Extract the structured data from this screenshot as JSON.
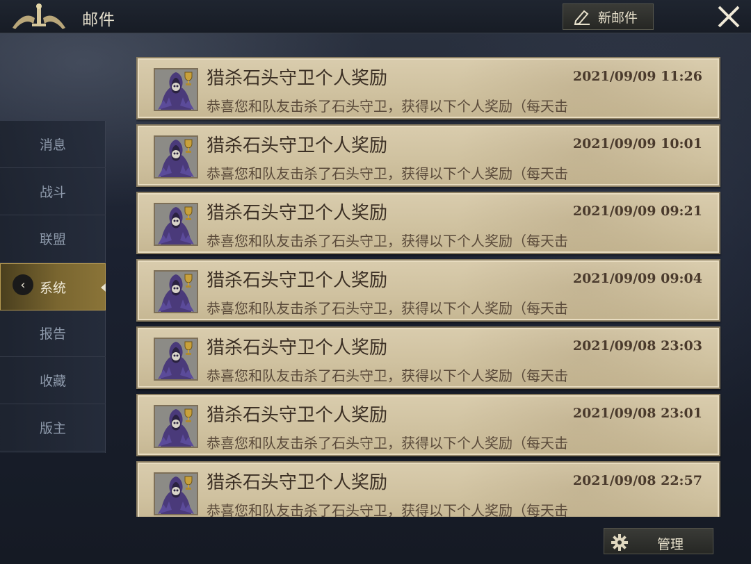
{
  "header": {
    "title": "邮件",
    "new_mail_label": "新邮件"
  },
  "sidebar": {
    "items": [
      {
        "label": "消息",
        "active": false
      },
      {
        "label": "战斗",
        "active": false
      },
      {
        "label": "联盟",
        "active": false
      },
      {
        "label": "系统",
        "active": true
      },
      {
        "label": "报告",
        "active": false
      },
      {
        "label": "收藏",
        "active": false
      },
      {
        "label": "版主",
        "active": false
      }
    ],
    "collapse_glyph": "‹"
  },
  "mails": [
    {
      "title": "猎杀石头守卫个人奖励",
      "time": "2021/09/09 11:26",
      "preview": "恭喜您和队友击杀了石头守卫，获得以下个人奖励（每天击"
    },
    {
      "title": "猎杀石头守卫个人奖励",
      "time": "2021/09/09 10:01",
      "preview": "恭喜您和队友击杀了石头守卫，获得以下个人奖励（每天击"
    },
    {
      "title": "猎杀石头守卫个人奖励",
      "time": "2021/09/09 09:21",
      "preview": "恭喜您和队友击杀了石头守卫，获得以下个人奖励（每天击"
    },
    {
      "title": "猎杀石头守卫个人奖励",
      "time": "2021/09/09 09:04",
      "preview": "恭喜您和队友击杀了石头守卫，获得以下个人奖励（每天击"
    },
    {
      "title": "猎杀石头守卫个人奖励",
      "time": "2021/09/08 23:03",
      "preview": "恭喜您和队友击杀了石头守卫，获得以下个人奖励（每天击"
    },
    {
      "title": "猎杀石头守卫个人奖励",
      "time": "2021/09/08 23:01",
      "preview": "恭喜您和队友击杀了石头守卫，获得以下个人奖励（每天击"
    },
    {
      "title": "猎杀石头守卫个人奖励",
      "time": "2021/09/08 22:57",
      "preview": "恭喜您和队友击杀了石头守卫，获得以下个人奖励（每天击"
    }
  ],
  "footer": {
    "manage_label": "管理"
  },
  "icons": {
    "emblem": "guild-emblem-icon",
    "new_mail": "pencil-icon",
    "close": "close-icon",
    "manage": "gear-icon",
    "mail_avatar": "hooded-skull-icon",
    "mail_badge": "trophy-icon"
  },
  "colors": {
    "card_bg": "#d4c6a6",
    "card_border": "#8c7f63",
    "active_tab": "#7a6630",
    "title_text": "#3b2f24"
  }
}
